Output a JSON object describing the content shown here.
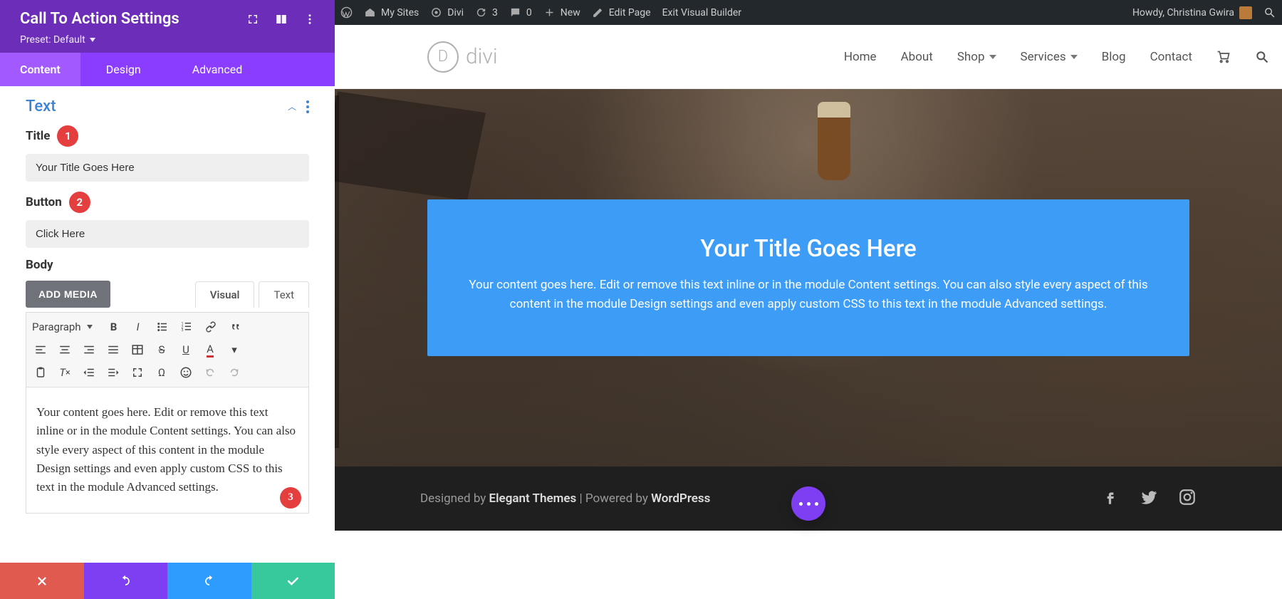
{
  "panel": {
    "title": "Call To Action Settings",
    "preset_label": "Preset: Default",
    "tabs": {
      "content": "Content",
      "design": "Design",
      "advanced": "Advanced"
    },
    "section_text": "Text",
    "title_label": "Title",
    "title_value": "Your Title Goes Here",
    "button_label": "Button",
    "button_value": "Click Here",
    "body_label": "Body",
    "add_media": "ADD MEDIA",
    "vt_visual": "Visual",
    "vt_text": "Text",
    "paragraph_label": "Paragraph",
    "body_value": "Your content goes here. Edit or remove this text inline or in the module Content settings. You can also style every aspect of this content in the module Design settings and even apply custom CSS to this text in the module Advanced settings.",
    "badges": {
      "one": "1",
      "two": "2",
      "three": "3"
    }
  },
  "wpbar": {
    "my_sites": "My Sites",
    "site_name": "Divi",
    "updates": "3",
    "comments": "0",
    "new": "New",
    "edit_page": "Edit Page",
    "exit_vb": "Exit Visual Builder",
    "howdy": "Howdy, Christina Gwira"
  },
  "site": {
    "logo_text": "divi",
    "nav": {
      "home": "Home",
      "about": "About",
      "shop": "Shop",
      "services": "Services",
      "blog": "Blog",
      "contact": "Contact"
    }
  },
  "cta": {
    "title": "Your Title Goes Here",
    "body": "Your content goes here. Edit or remove this text inline or in the module Content settings. You can also style every aspect of this content in the module Design settings and even apply custom CSS to this text in the module Advanced settings."
  },
  "footer": {
    "designed_by": "Designed by ",
    "theme": "Elegant Themes",
    "sep": " | Powered by ",
    "powered": "WordPress"
  }
}
